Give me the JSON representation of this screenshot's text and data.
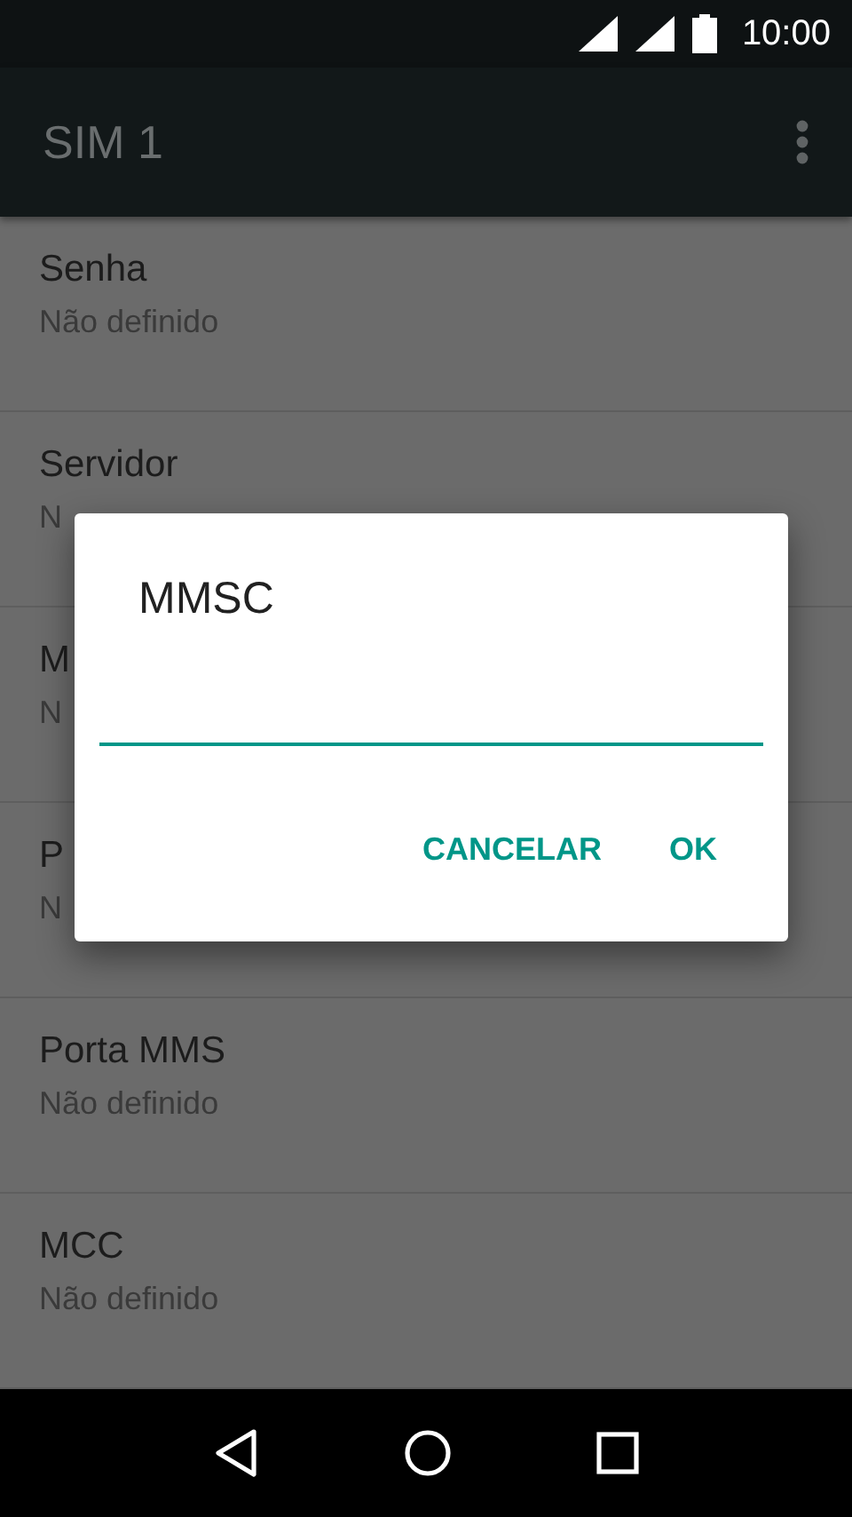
{
  "status_bar": {
    "time": "10:00"
  },
  "app_bar": {
    "title": "SIM 1"
  },
  "settings": [
    {
      "title": "Senha",
      "summary": "Não definido"
    },
    {
      "title": "Servidor",
      "summary": "N"
    },
    {
      "title": "M",
      "summary": "N"
    },
    {
      "title": "P",
      "summary": "N"
    },
    {
      "title": "Porta MMS",
      "summary": "Não definido"
    },
    {
      "title": "MCC",
      "summary": "Não definido"
    }
  ],
  "dialog": {
    "title": "MMSC",
    "buttons": [
      "CANCELAR",
      "OK"
    ]
  }
}
